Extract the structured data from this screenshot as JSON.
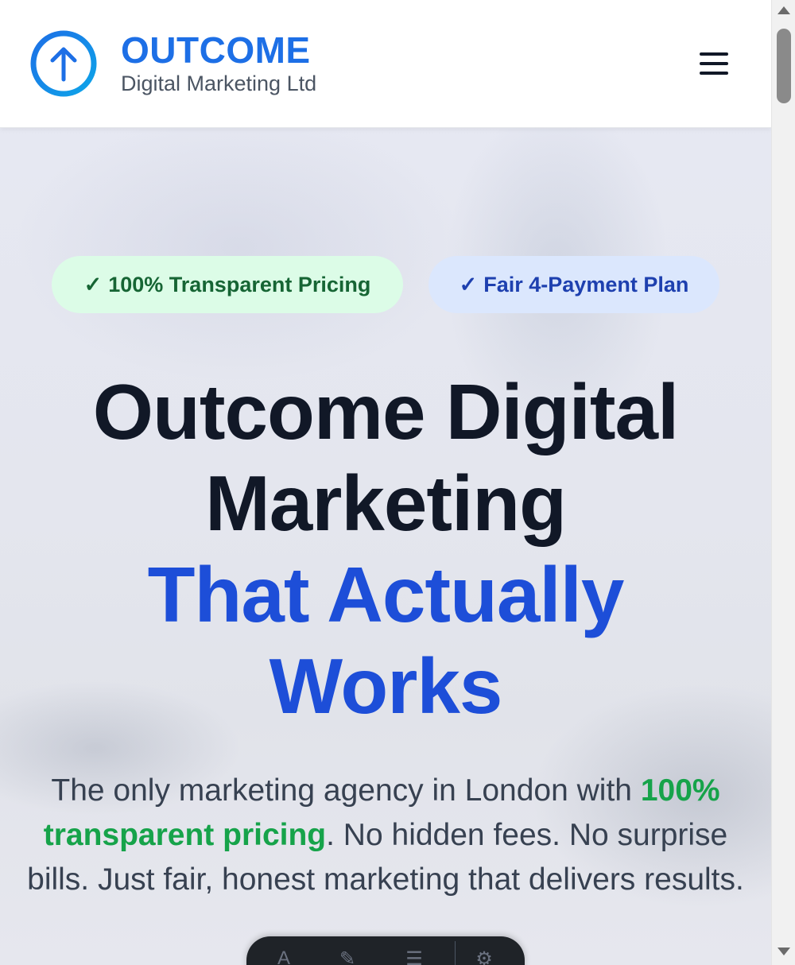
{
  "header": {
    "brand_name": "OUTCOME",
    "brand_subtitle": "Digital Marketing Ltd",
    "logo_icon": "arrow-up-circle-icon",
    "menu_icon": "hamburger-menu-icon"
  },
  "hero": {
    "badges": [
      {
        "check": "✓",
        "label": "100% Transparent Pricing"
      },
      {
        "check": "✓",
        "label": "Fair 4-Payment Plan"
      }
    ],
    "headline": {
      "line1": "Outcome Digital",
      "line2": "Marketing",
      "line3": "That Actually",
      "line4": "Works"
    },
    "subtext": {
      "part1": "The only marketing agency in London with ",
      "highlight": "100% transparent pricing",
      "part2": ". No hidden fees. No surprise bills. Just fair, honest marketing that delivers results."
    }
  },
  "colors": {
    "brand_blue": "#1d6fe6",
    "headline_blue": "#1d4ed8",
    "highlight_green": "#16a34a"
  }
}
